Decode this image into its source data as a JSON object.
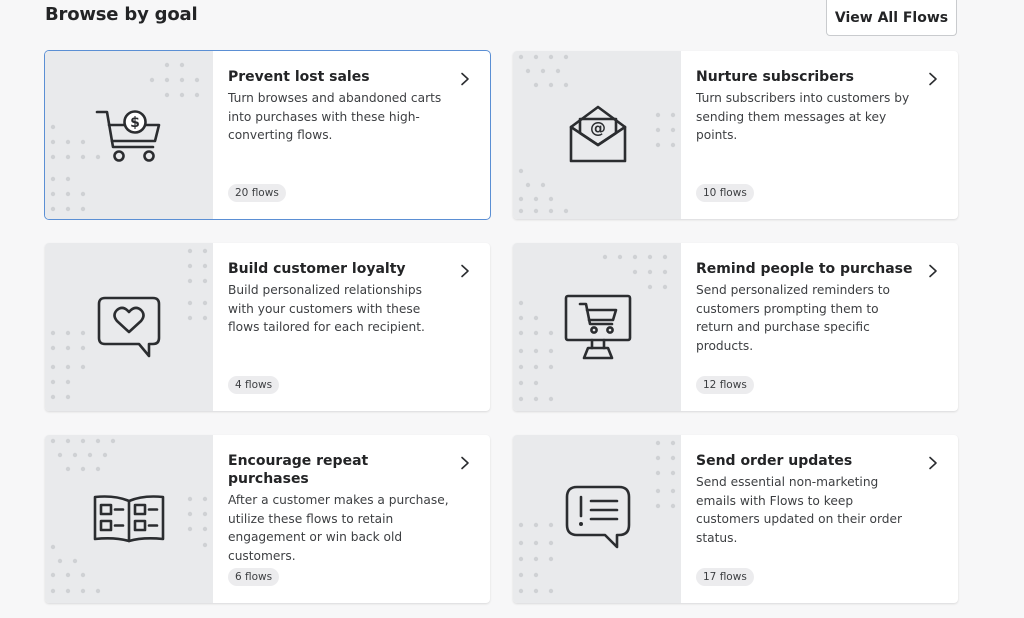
{
  "section": {
    "title": "Browse by goal",
    "view_all_label": "View All Flows"
  },
  "cards": [
    {
      "title": "Prevent lost sales",
      "description": "Turn browses and abandoned carts into purchases with these high-converting flows.",
      "count": "20 flows",
      "icon": "dollar-cart-icon",
      "selected": true
    },
    {
      "title": "Nurture subscribers",
      "description": "Turn subscribers into customers by sending them messages at key points.",
      "count": "10 flows",
      "icon": "email-envelope-icon",
      "selected": false
    },
    {
      "title": "Build customer loyalty",
      "description": "Build personalized relationships with your customers with these flows tailored for each recipient.",
      "count": "4 flows",
      "icon": "heart-speech-bubble-icon",
      "selected": false
    },
    {
      "title": "Remind people to purchase",
      "description": "Send personalized reminders to customers prompting them to return and purchase specific products.",
      "count": "12 flows",
      "icon": "cart-monitor-icon",
      "selected": false
    },
    {
      "title": "Encourage repeat purchases",
      "description": "After a customer makes a purchase, utilize these flows to retain engagement or win back old customers.",
      "count": "6 flows",
      "icon": "open-book-checklist-icon",
      "selected": false
    },
    {
      "title": "Send order updates",
      "description": "Send essential non-marketing emails with Flows to keep customers updated on their order status.",
      "count": "17 flows",
      "icon": "alert-speech-bubble-icon",
      "selected": false
    }
  ],
  "colors": {
    "selected_border": "#5b8fd4",
    "art_background": "#e9eaec",
    "dots": "#cfd1d4",
    "icon_stroke": "#2b2d30"
  }
}
